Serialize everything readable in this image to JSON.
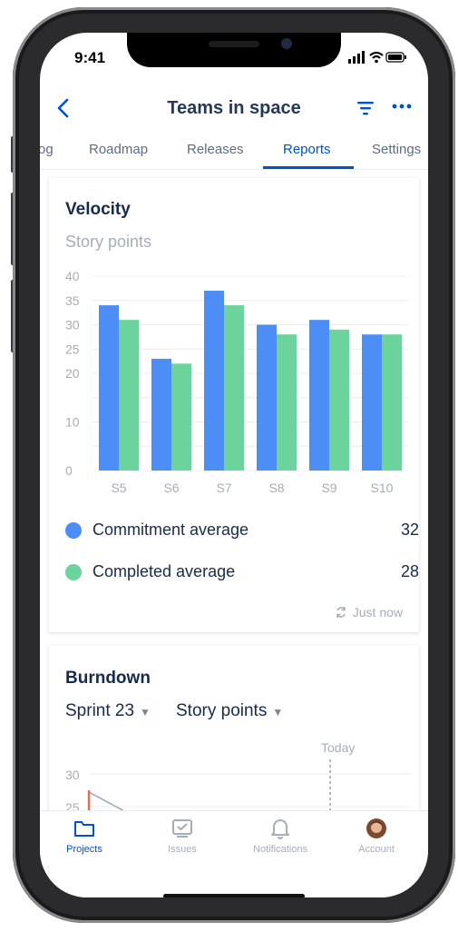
{
  "status": {
    "time": "9:41"
  },
  "header": {
    "title": "Teams in space"
  },
  "tabs": [
    {
      "label": "og"
    },
    {
      "label": "Roadmap"
    },
    {
      "label": "Releases"
    },
    {
      "label": "Reports",
      "active": true
    },
    {
      "label": "Settings"
    }
  ],
  "velocity": {
    "title": "Velocity",
    "subtitle": "Story points",
    "legend": [
      {
        "label": "Commitment average",
        "value": "32",
        "color": "#4c8df6"
      },
      {
        "label": "Completed average",
        "value": "28",
        "color": "#6bd39b"
      }
    ],
    "refresh_text": "Just now"
  },
  "burndown": {
    "title": "Burndown",
    "sprint_select": "Sprint 23",
    "unit_select": "Story points",
    "today_label": "Today"
  },
  "bottom_nav": [
    {
      "label": "Projects",
      "icon": "folder-icon",
      "active": true
    },
    {
      "label": "Issues",
      "icon": "issues-icon"
    },
    {
      "label": "Notifications",
      "icon": "bell-icon"
    },
    {
      "label": "Account",
      "icon": "avatar-icon"
    }
  ],
  "colors": {
    "accent": "#0052cc",
    "commitment": "#4c8df6",
    "completed": "#6bd39b",
    "burndown_line": "#f06a4a"
  },
  "chart_data": [
    {
      "type": "bar",
      "title": "Velocity",
      "subtitle": "Story points",
      "categories": [
        "S5",
        "S6",
        "S7",
        "S8",
        "S9",
        "S10"
      ],
      "series": [
        {
          "values": [
            34,
            23,
            37,
            30,
            31,
            28
          ]
        },
        {
          "values": [
            31,
            22,
            34,
            28,
            29,
            28
          ]
        }
      ],
      "ylim": [
        0,
        40
      ],
      "yticks": [
        0,
        5,
        10,
        15,
        20,
        25,
        30,
        35,
        40
      ],
      "ytick_labels": [
        "0",
        "10",
        "20",
        "25",
        "30",
        "35",
        "40"
      ],
      "grid": true
    },
    {
      "type": "line",
      "title": "Burndown",
      "yticks_visible": [
        "30",
        "25"
      ],
      "annotation": "Today"
    }
  ]
}
